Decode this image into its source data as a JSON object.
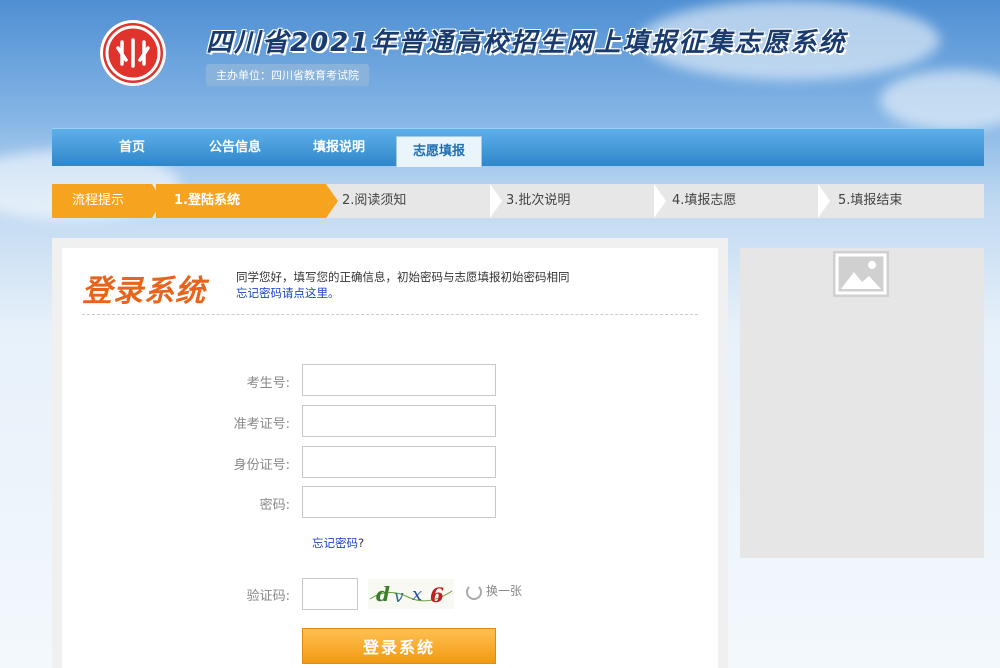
{
  "header": {
    "title": "四川省2021年普通高校招生网上填报征集志愿系统",
    "sponsor": "主办单位：四川省教育考试院"
  },
  "nav": {
    "items": [
      {
        "label": "首页"
      },
      {
        "label": "公告信息"
      },
      {
        "label": "填报说明"
      },
      {
        "label": "志愿填报",
        "active": true
      }
    ]
  },
  "steps": {
    "prompt": "流程提示",
    "items": [
      {
        "label": "1.登陆系统",
        "active": true
      },
      {
        "label": "2.阅读须知"
      },
      {
        "label": "3.批次说明"
      },
      {
        "label": "4.填报志愿"
      },
      {
        "label": "5.填报结束"
      }
    ]
  },
  "login": {
    "title": "登录系统",
    "intro": "同学您好，填写您的正确信息，初始密码与志愿填报初始密码相同",
    "forgot_link": "忘记密码请点这里。",
    "fields": {
      "exam_no_label": "考生号:",
      "admission_no_label": "准考证号:",
      "id_no_label": "身份证号:",
      "password_label": "密码:",
      "captcha_label": "验证码:"
    },
    "forgot_password": "忘记密码",
    "forgot_q": "?",
    "captcha_text": "dvx6",
    "refresh_label": "换一张",
    "submit": "登录系统"
  },
  "side": {
    "image_icon": "image-placeholder-icon"
  },
  "colors": {
    "nav_blue": "#2f86c9",
    "step_orange": "#f6a31f",
    "title_orange": "#e8641c",
    "link_blue": "#1a43c8"
  }
}
